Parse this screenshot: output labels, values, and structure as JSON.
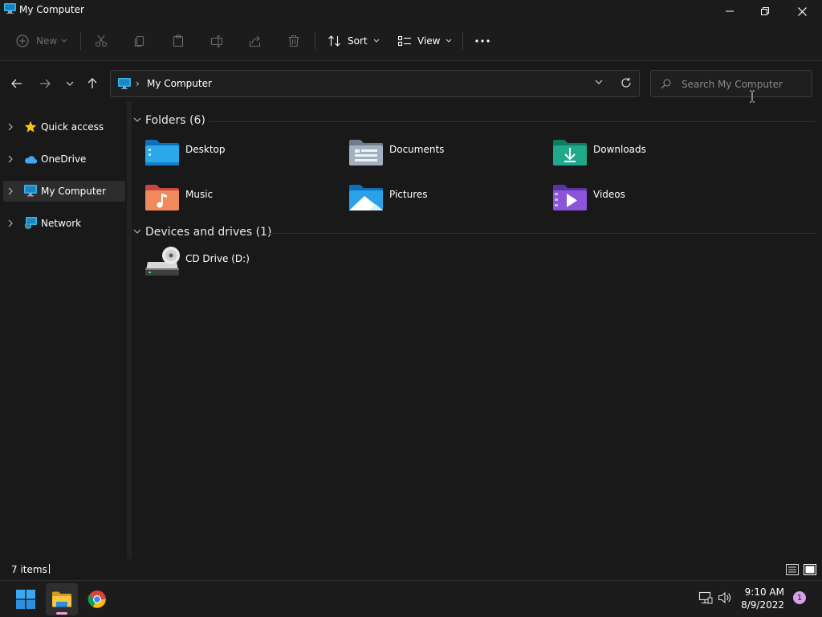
{
  "window": {
    "title": "My Computer"
  },
  "toolbar": {
    "new_label": "New",
    "sort_label": "Sort",
    "view_label": "View"
  },
  "address": {
    "crumb": "My Computer"
  },
  "search": {
    "placeholder": "Search My Computer"
  },
  "sidebar": {
    "items": [
      {
        "label": "Quick access"
      },
      {
        "label": "OneDrive"
      },
      {
        "label": "My Computer"
      },
      {
        "label": "Network"
      }
    ]
  },
  "main": {
    "folders_header": "Folders (6)",
    "folders": [
      {
        "label": "Desktop"
      },
      {
        "label": "Documents"
      },
      {
        "label": "Downloads"
      },
      {
        "label": "Music"
      },
      {
        "label": "Pictures"
      },
      {
        "label": "Videos"
      }
    ],
    "devices_header": "Devices and drives (1)",
    "devices": [
      {
        "label": "CD Drive (D:)"
      }
    ]
  },
  "status": {
    "count": "7 items"
  },
  "taskbar": {
    "time": "9:10 AM",
    "date": "8/9/2022",
    "notifications": "1"
  },
  "colors": {
    "background": "#191919",
    "folder_blue": "#1a9ee8",
    "folder_green": "#1fa88a",
    "folder_orange": "#f08a5d",
    "folder_purple": "#8a55d8",
    "notification_badge": "#d8a0e8"
  }
}
